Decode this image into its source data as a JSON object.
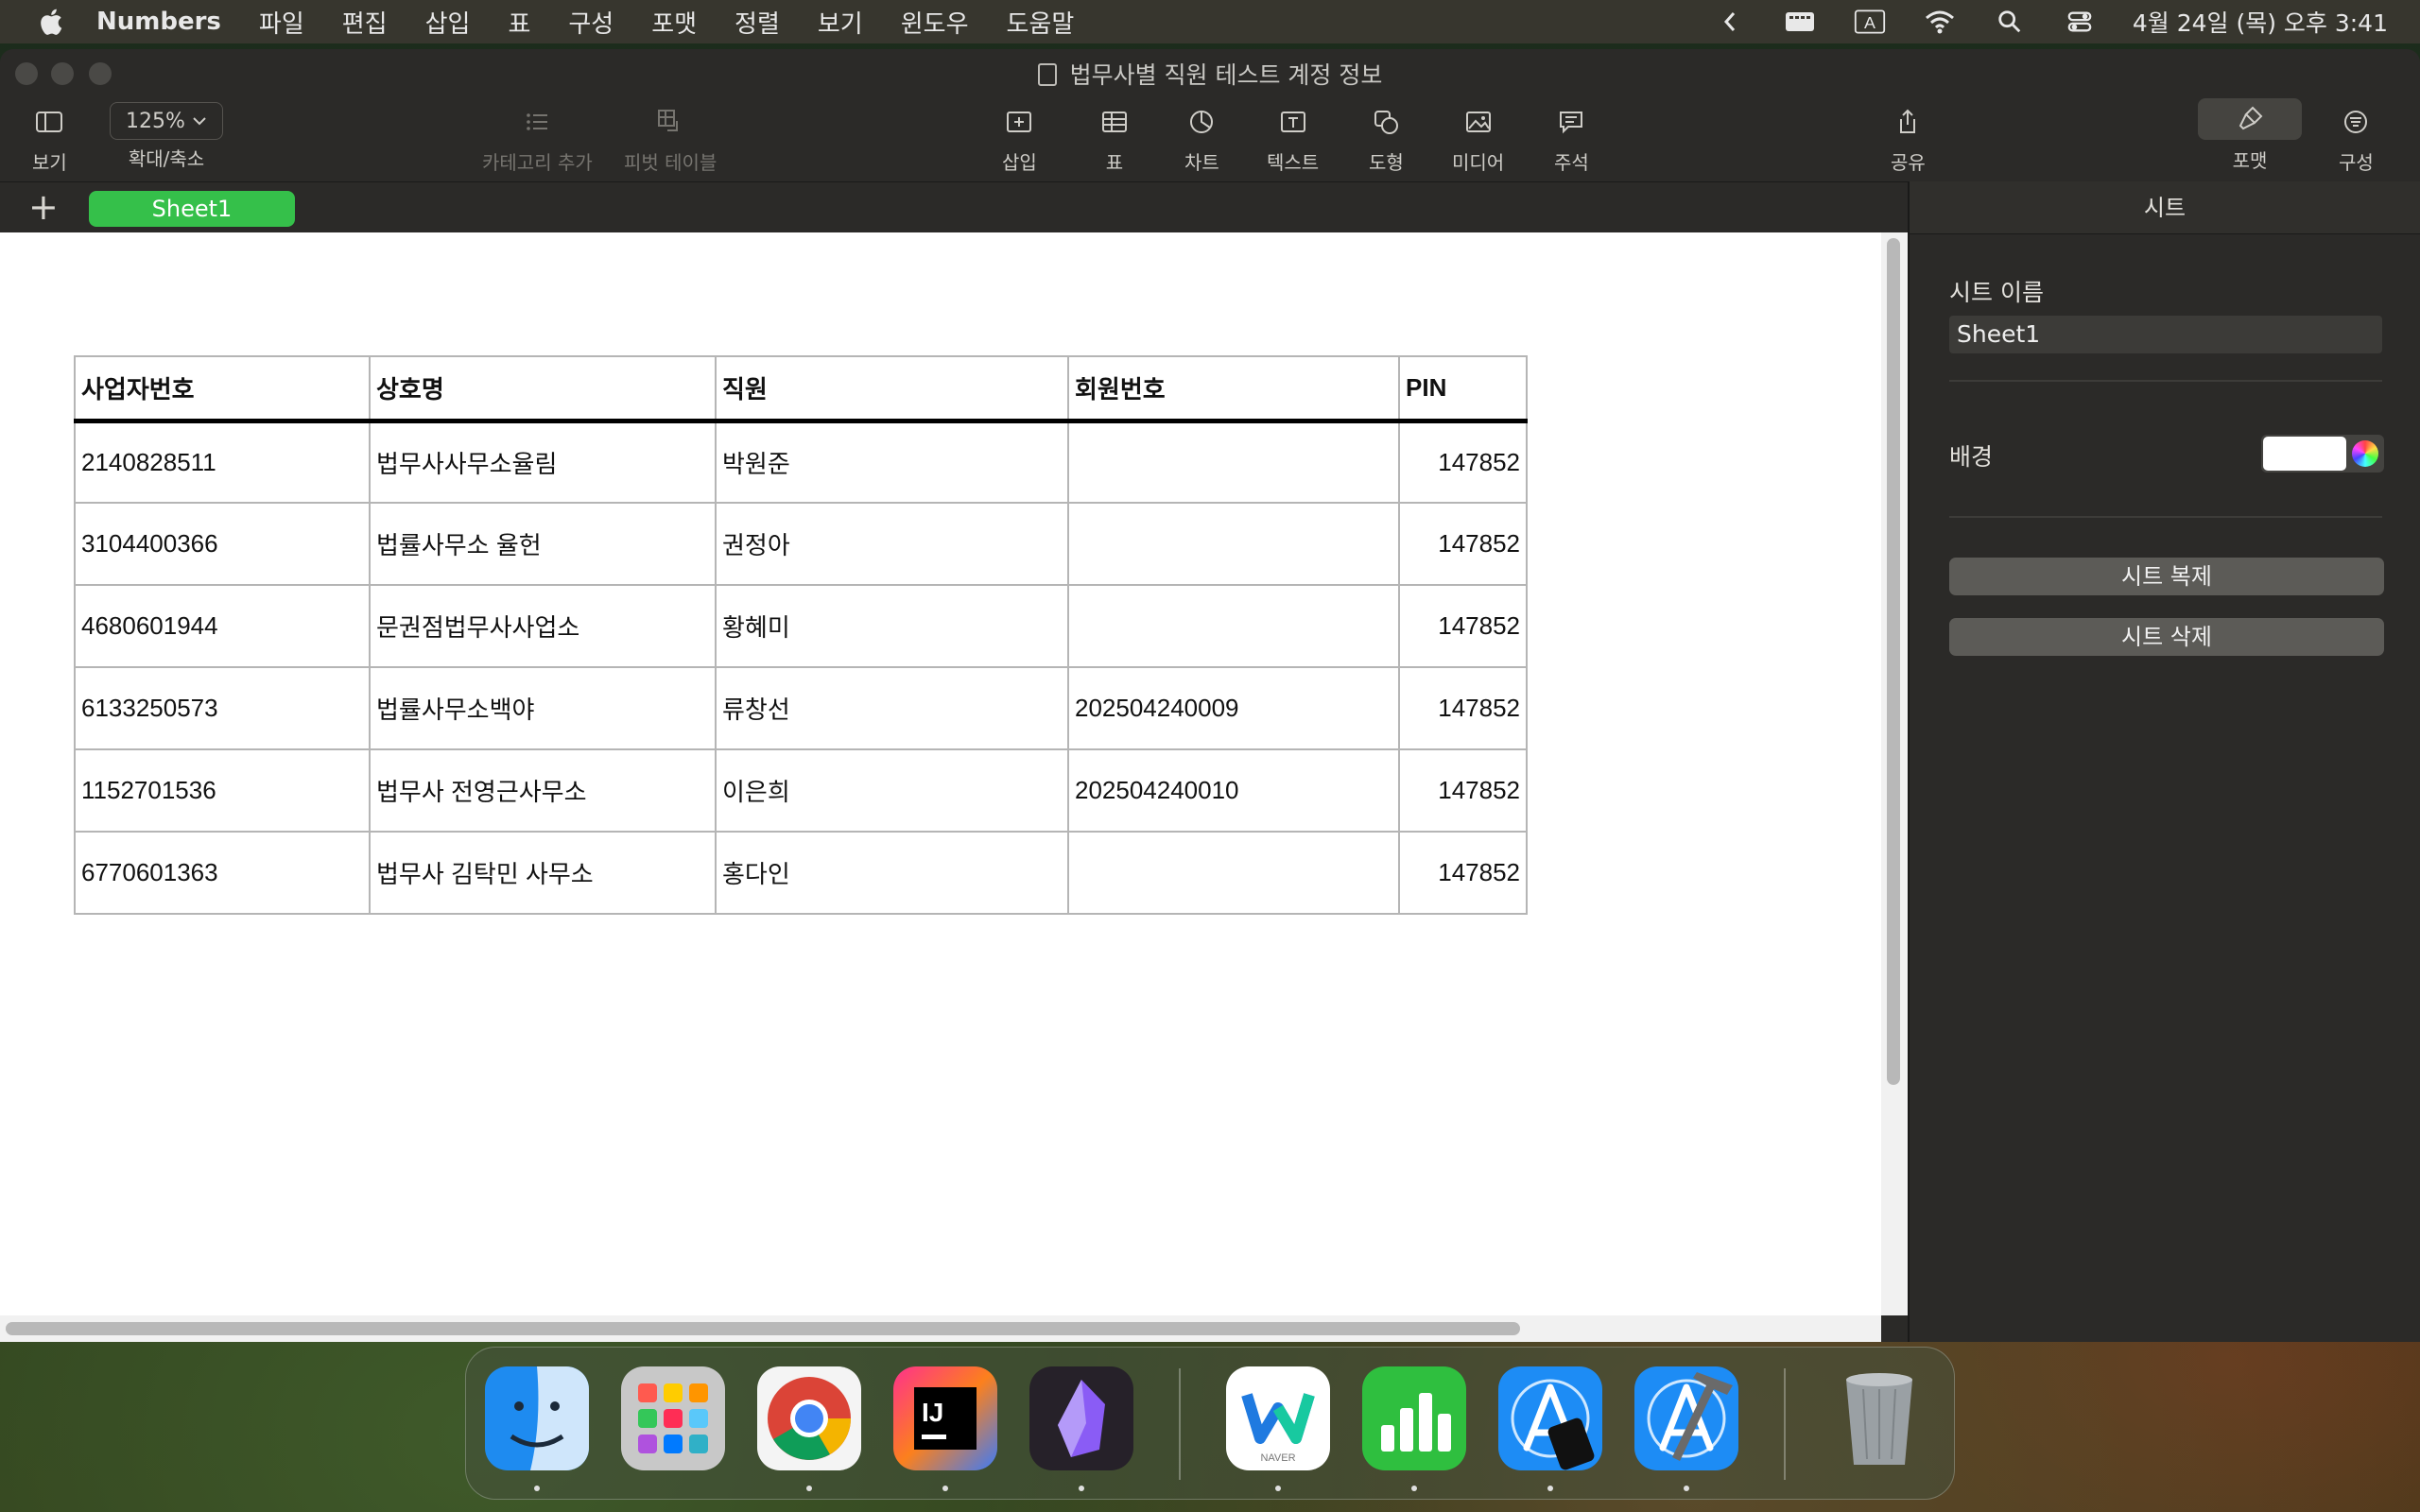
{
  "menubar": {
    "app_name": "Numbers",
    "items": [
      "파일",
      "편집",
      "삽입",
      "표",
      "구성",
      "포맷",
      "정렬",
      "보기",
      "윈도우",
      "도움말"
    ],
    "status_icons": [
      "chevron-left-icon",
      "keyboard-brightness-icon",
      "input-source-icon",
      "wifi-icon",
      "search-icon",
      "control-center-icon"
    ],
    "input_source_label": "A",
    "clock": "4월 24일 (목) 오후 3:41"
  },
  "window": {
    "title": "법무사별 직원 테스트 계정 정보"
  },
  "toolbar": {
    "view_label": "보기",
    "zoom_value": "125%",
    "zoom_label": "확대/축소",
    "add_category_label": "카테고리 추가",
    "pivot_table_label": "피벗 테이블",
    "insert_label": "삽입",
    "table_label": "표",
    "chart_label": "차트",
    "text_label": "텍스트",
    "shape_label": "도형",
    "media_label": "미디어",
    "comment_label": "주석",
    "share_label": "공유",
    "format_label": "포맷",
    "organize_label": "구성"
  },
  "sheets": {
    "add_label": "+",
    "tabs": [
      "Sheet1"
    ],
    "accent": "#35c04a"
  },
  "table": {
    "headers": [
      "사업자번호",
      "상호명",
      "직원",
      "회원번호",
      "PIN"
    ],
    "rows": [
      [
        "2140828511",
        "법무사사무소율림",
        "박원준",
        "",
        "147852"
      ],
      [
        "3104400366",
        "법률사무소 율헌",
        "권정아",
        "",
        "147852"
      ],
      [
        "4680601944",
        "문권점법무사사업소",
        "황혜미",
        "",
        "147852"
      ],
      [
        "6133250573",
        "법률사무소백야",
        "류창선",
        "202504240009",
        "147852"
      ],
      [
        "1152701536",
        "법무사 전영근사무소",
        "이은희",
        "202504240010",
        "147852"
      ],
      [
        "6770601363",
        "법무사 김탁민 사무소",
        "홍다인",
        "",
        "147852"
      ]
    ]
  },
  "inspector": {
    "header": "시트",
    "sheet_name_label": "시트 이름",
    "sheet_name_value": "Sheet1",
    "background_label": "배경",
    "background_color": "#ffffff",
    "duplicate_button": "시트 복제",
    "delete_button": "시트 삭제"
  },
  "dock": {
    "apps": [
      "Finder",
      "Launchpad",
      "Chrome",
      "IntelliJ IDEA",
      "Obsidian",
      "Whale",
      "Numbers",
      "Simulator",
      "Xcode",
      "Trash"
    ],
    "whale_caption": "NAVER",
    "intellij_caption": "IJ"
  }
}
